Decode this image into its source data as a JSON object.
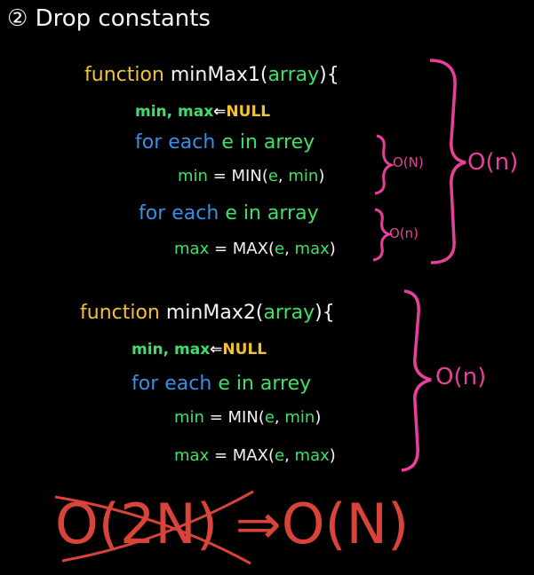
{
  "title": {
    "number": "②",
    "text": "Drop constants"
  },
  "colors": {
    "keyword": "#f2c230",
    "identifier": "#f4f4f4",
    "variable": "#3fe06a",
    "loop": "#3a8ee6",
    "brace": "#e8409a",
    "result": "#d8443a"
  },
  "block1": {
    "keyword": "function",
    "name": "minMax1",
    "open_paren": "(",
    "param": "array",
    "close": "){",
    "init_vars": "min, max",
    "assign_arrow": "⇐",
    "init_value": "NULL",
    "loop1": {
      "kw": "for each",
      "var": "e",
      "in": "in",
      "coll": "arrey"
    },
    "stmt1": {
      "lhs": "min",
      "eq": "=",
      "fn": "MIN(",
      "a": "e",
      "sep": ",",
      "b": "min",
      "end": ")"
    },
    "loop2": {
      "kw": "for each",
      "var": "e",
      "in": "in",
      "coll": "array"
    },
    "stmt2": {
      "lhs": "max",
      "eq": "=",
      "fn": "MAX(",
      "a": "e",
      "sep": ",",
      "b": "max",
      "end": ")"
    },
    "loop1_complexity": "O(N)",
    "loop2_complexity": "O(n)",
    "total_complexity": "O(n)"
  },
  "block2": {
    "keyword": "function",
    "name": "minMax2",
    "open_paren": "(",
    "param": "array",
    "close": "){",
    "init_vars": "min, max",
    "assign_arrow": "⇐",
    "init_value": "NULL",
    "loop": {
      "kw": "for each",
      "var": "e",
      "in": "in",
      "coll": "arrey"
    },
    "stmt1": {
      "lhs": "min",
      "eq": "=",
      "fn": "MIN(",
      "a": "e",
      "sep": ",",
      "b": "min",
      "end": ")"
    },
    "stmt2": {
      "lhs": "max",
      "eq": "=",
      "fn": "MAX(",
      "a": "e",
      "sep": ",",
      "b": "max",
      "end": ")"
    },
    "total_complexity": "O(n)"
  },
  "conclusion": {
    "crossed": "O(2N)",
    "arrow": "⇒",
    "result": "O(N)"
  }
}
